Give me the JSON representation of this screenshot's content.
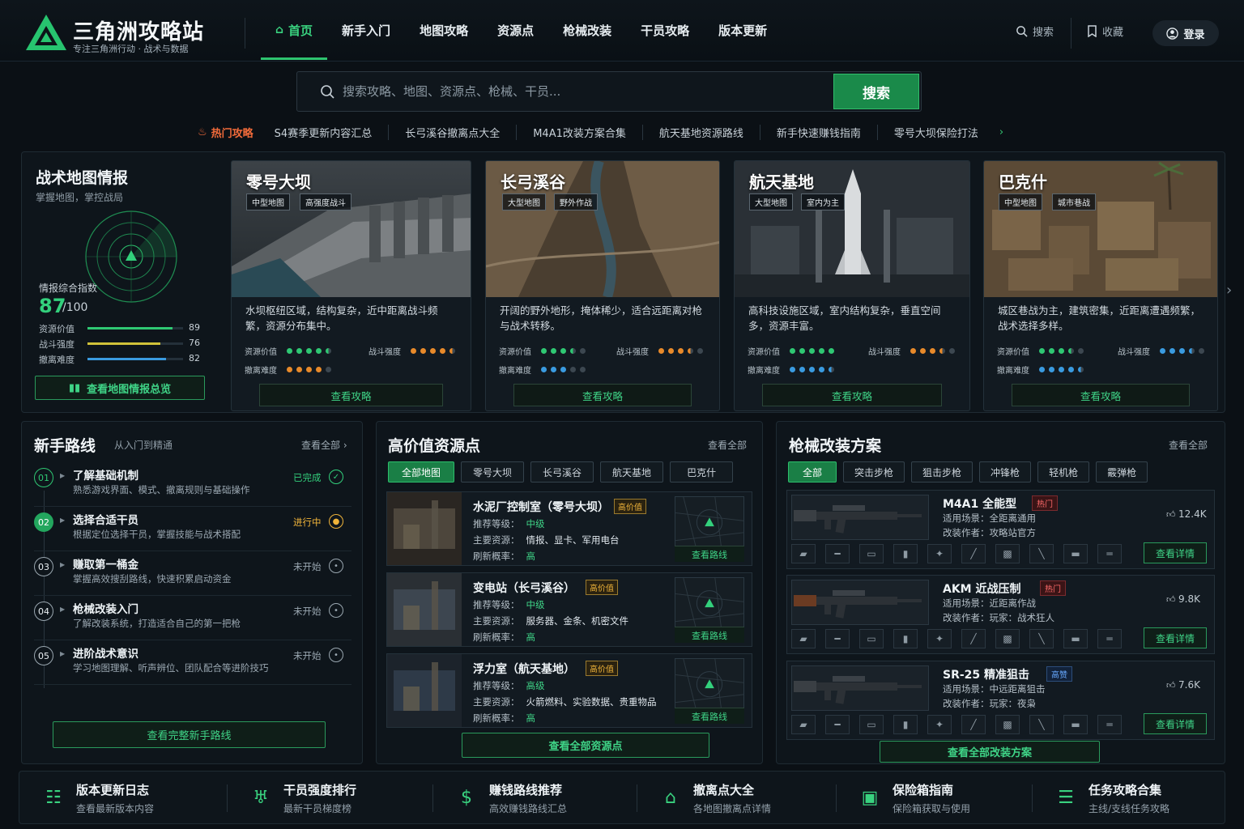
{
  "header": {
    "brand": "三角洲攻略站",
    "tagline": "专注三角洲行动 · 战术与数据",
    "nav": [
      "首页",
      "新手入门",
      "地图攻略",
      "资源点",
      "枪械改装",
      "干员攻略",
      "版本更新"
    ],
    "search_label": "搜索",
    "favorites_label": "收藏",
    "login_label": "登录"
  },
  "search": {
    "placeholder": "搜索攻略、地图、资源点、枪械、干员...",
    "button": "搜索"
  },
  "hot": {
    "label": "热门攻略",
    "items": [
      "S4赛季更新内容汇总",
      "长弓溪谷撤离点大全",
      "M4A1改装方案合集",
      "航天基地资源路线",
      "新手快速赚钱指南",
      "零号大坝保险打法"
    ]
  },
  "intel": {
    "title": "战术地图情报",
    "subtitle": "掌握地图，掌控战局",
    "score_label": "情报综合指数",
    "score": "87",
    "score_max": "/100",
    "stats": [
      {
        "label": "资源价值",
        "value": 89,
        "color": "#2fc873"
      },
      {
        "label": "战斗强度",
        "value": 76,
        "color": "#d0c23a"
      },
      {
        "label": "撤离难度",
        "value": 82,
        "color": "#3a9be0"
      }
    ],
    "button": "查看地图情报总览"
  },
  "maps": [
    {
      "name": "零号大坝",
      "tags": [
        "中型地图",
        "高强度战斗"
      ],
      "desc": "水坝枢纽区域，结构复杂，近中距离战斗频繁，资源分布集中。",
      "resource_label": "资源价值",
      "resource": 4.5,
      "combat_label": "战斗强度",
      "combat": 4.5,
      "combat_color": "#e88a2a",
      "extract_label": "撤离难度",
      "extract": 4,
      "extract_color": "#e88a2a",
      "button": "查看攻略"
    },
    {
      "name": "长弓溪谷",
      "tags": [
        "大型地图",
        "野外作战"
      ],
      "desc": "开阔的野外地形，掩体稀少，适合远距离对枪与战术转移。",
      "resource_label": "资源价值",
      "resource": 3.5,
      "combat_label": "战斗强度",
      "combat": 3.5,
      "combat_color": "#e88a2a",
      "extract_label": "撤离难度",
      "extract": 3,
      "extract_color": "#3a9be0",
      "button": "查看攻略"
    },
    {
      "name": "航天基地",
      "tags": [
        "大型地图",
        "室内为主"
      ],
      "desc": "高科技设施区域，室内结构复杂，垂直空间多，资源丰富。",
      "resource_label": "资源价值",
      "resource": 5,
      "combat_label": "战斗强度",
      "combat": 3.5,
      "combat_color": "#e88a2a",
      "extract_label": "撤离难度",
      "extract": 4.5,
      "extract_color": "#3a9be0",
      "button": "查看攻略"
    },
    {
      "name": "巴克什",
      "tags": [
        "中型地图",
        "城市巷战"
      ],
      "desc": "城区巷战为主，建筑密集，近距离遭遇频繁，战术选择多样。",
      "resource_label": "资源价值",
      "resource": 3.5,
      "combat_label": "战斗强度",
      "combat": 3.5,
      "combat_color": "#3a9be0",
      "extract_label": "撤离难度",
      "extract": 4.5,
      "extract_color": "#3a9be0",
      "button": "查看攻略"
    }
  ],
  "newbie": {
    "title": "新手路线",
    "subtitle": "从入门到精通",
    "more": "查看全部",
    "steps": [
      {
        "num": "01",
        "title": "了解基础机制",
        "desc": "熟悉游戏界面、模式、撤离规则与基础操作",
        "status": "已完成"
      },
      {
        "num": "02",
        "title": "选择合适干员",
        "desc": "根据定位选择干员，掌握技能与战术搭配",
        "status": "进行中"
      },
      {
        "num": "03",
        "title": "赚取第一桶金",
        "desc": "掌握高效搜刮路线，快速积累启动资金",
        "status": "未开始"
      },
      {
        "num": "04",
        "title": "枪械改装入门",
        "desc": "了解改装系统，打造适合自己的第一把枪",
        "status": "未开始"
      },
      {
        "num": "05",
        "title": "进阶战术意识",
        "desc": "学习地图理解、听声辨位、团队配合等进阶技巧",
        "status": "未开始"
      }
    ],
    "button": "查看完整新手路线"
  },
  "resources": {
    "title": "高价值资源点",
    "more": "查看全部",
    "filters": [
      "全部地图",
      "零号大坝",
      "长弓溪谷",
      "航天基地",
      "巴克什"
    ],
    "badge": "高价值",
    "level_label": "推荐等级：",
    "main_label": "主要资源：",
    "rate_label": "刷新概率：",
    "items": [
      {
        "name": "水泥厂控制室（零号大坝）",
        "level": "中级",
        "main": "情报、显卡、军用电台",
        "rate": "高"
      },
      {
        "name": "变电站（长弓溪谷）",
        "level": "中级",
        "main": "服务器、金条、机密文件",
        "rate": "高"
      },
      {
        "name": "浮力室（航天基地）",
        "level": "高级",
        "main": "火箭燃料、实验数据、贵重物品",
        "rate": "高"
      }
    ],
    "route_button": "查看路线",
    "button": "查看全部资源点"
  },
  "guns": {
    "title": "枪械改装方案",
    "more": "查看全部",
    "filters": [
      "全部",
      "突击步枪",
      "狙击步枪",
      "冲锋枪",
      "轻机枪",
      "霰弹枪"
    ],
    "items": [
      {
        "name": "M4A1 全能型",
        "badge": "热门",
        "badge_type": "hot",
        "scene": "适用场景：全距离通用",
        "author": "改装作者：攻略站官方",
        "likes": "12.4K"
      },
      {
        "name": "AKM 近战压制",
        "badge": "热门",
        "badge_type": "hot",
        "scene": "适用场景：近距离作战",
        "author": "改装作者：玩家：战术狂人",
        "likes": "9.8K"
      },
      {
        "name": "SR-25 精准狙击",
        "badge": "高赞",
        "badge_type": "blue",
        "scene": "适用场景：中远距离狙击",
        "author": "改装作者：玩家：夜枭",
        "likes": "7.6K"
      }
    ],
    "detail_button": "查看详情",
    "button": "查看全部改装方案"
  },
  "footer": [
    {
      "title": "版本更新日志",
      "sub": "查看最新版本内容",
      "icon": "document-list-icon"
    },
    {
      "title": "干员强度排行",
      "sub": "最新干员梯度榜",
      "icon": "trophy-icon"
    },
    {
      "title": "赚钱路线推荐",
      "sub": "高效赚钱路线汇总",
      "icon": "money-icon"
    },
    {
      "title": "撤离点大全",
      "sub": "各地图撤离点详情",
      "icon": "extraction-icon"
    },
    {
      "title": "保险箱指南",
      "sub": "保险箱获取与使用",
      "icon": "safe-icon"
    },
    {
      "title": "任务攻略合集",
      "sub": "主线/支线任务攻略",
      "icon": "task-list-icon"
    }
  ]
}
